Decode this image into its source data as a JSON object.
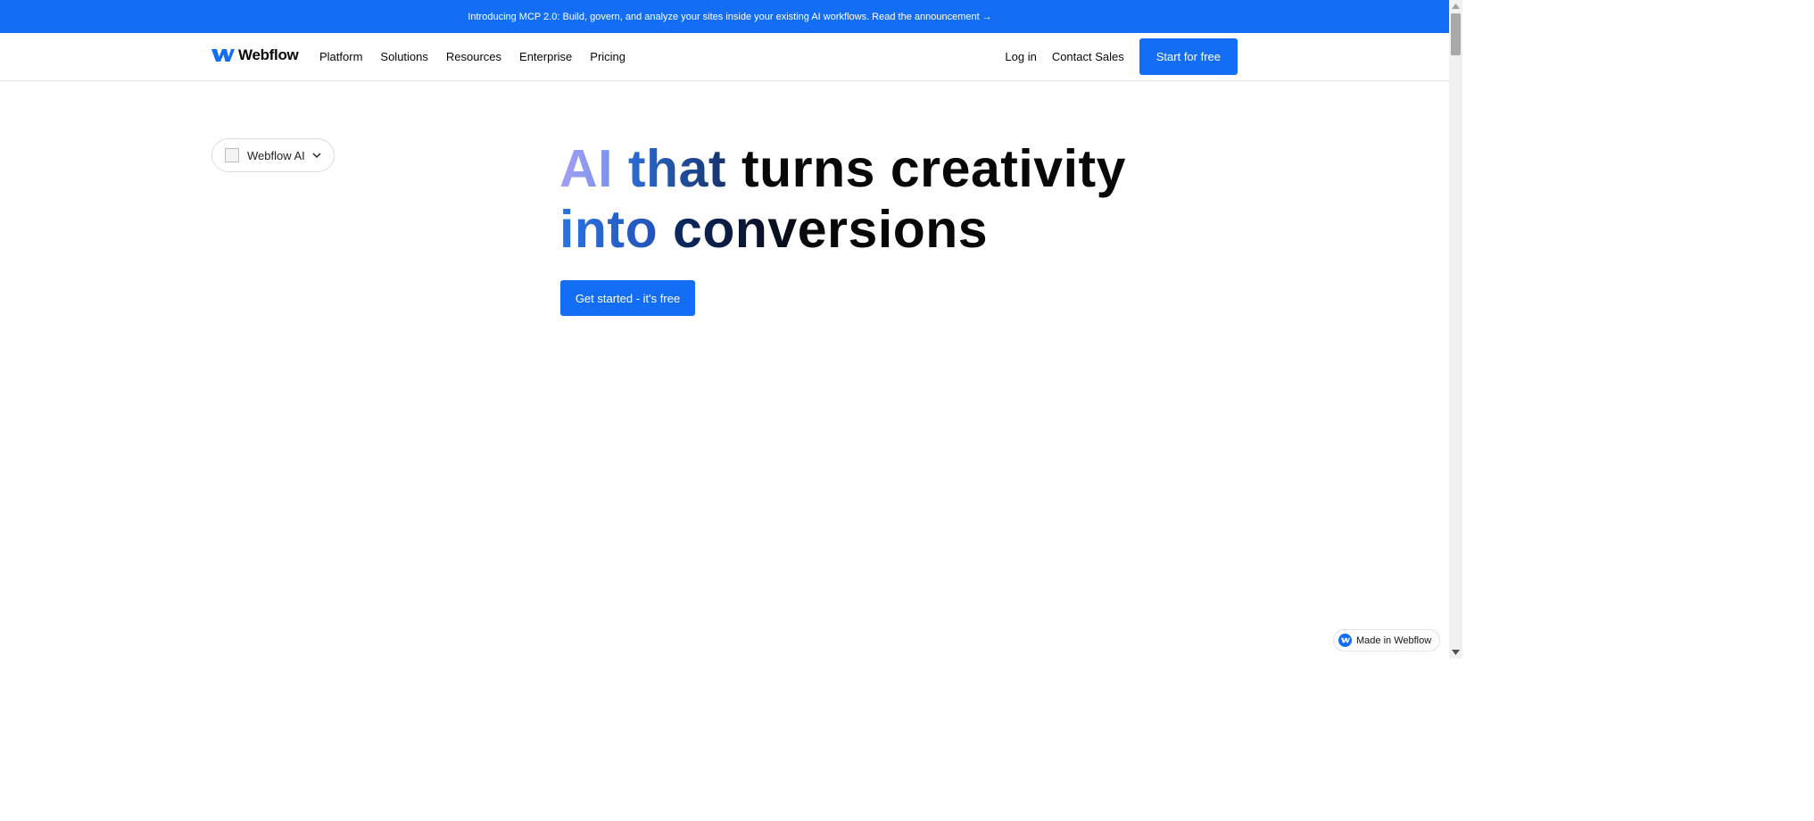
{
  "announcement": {
    "text": "Introducing MCP 2.0: Build, govern, and analyze your sites inside your existing AI workflows. Read the announcement",
    "arrow": "→"
  },
  "nav": {
    "logo_text": "Webflow",
    "links": [
      "Platform",
      "Solutions",
      "Resources",
      "Enterprise",
      "Pricing"
    ],
    "login": "Log in",
    "contact": "Contact Sales",
    "cta": "Start for free"
  },
  "product_pill": {
    "label": "Webflow AI"
  },
  "hero": {
    "line1": [
      "AI",
      "that",
      "turns creativity"
    ],
    "line2": [
      "into",
      "conversions"
    ],
    "cta": "Get started - it's free"
  },
  "badge": {
    "label": "Made in Webflow"
  },
  "colors": {
    "brand_blue": "#146ef5",
    "text": "#080808"
  }
}
